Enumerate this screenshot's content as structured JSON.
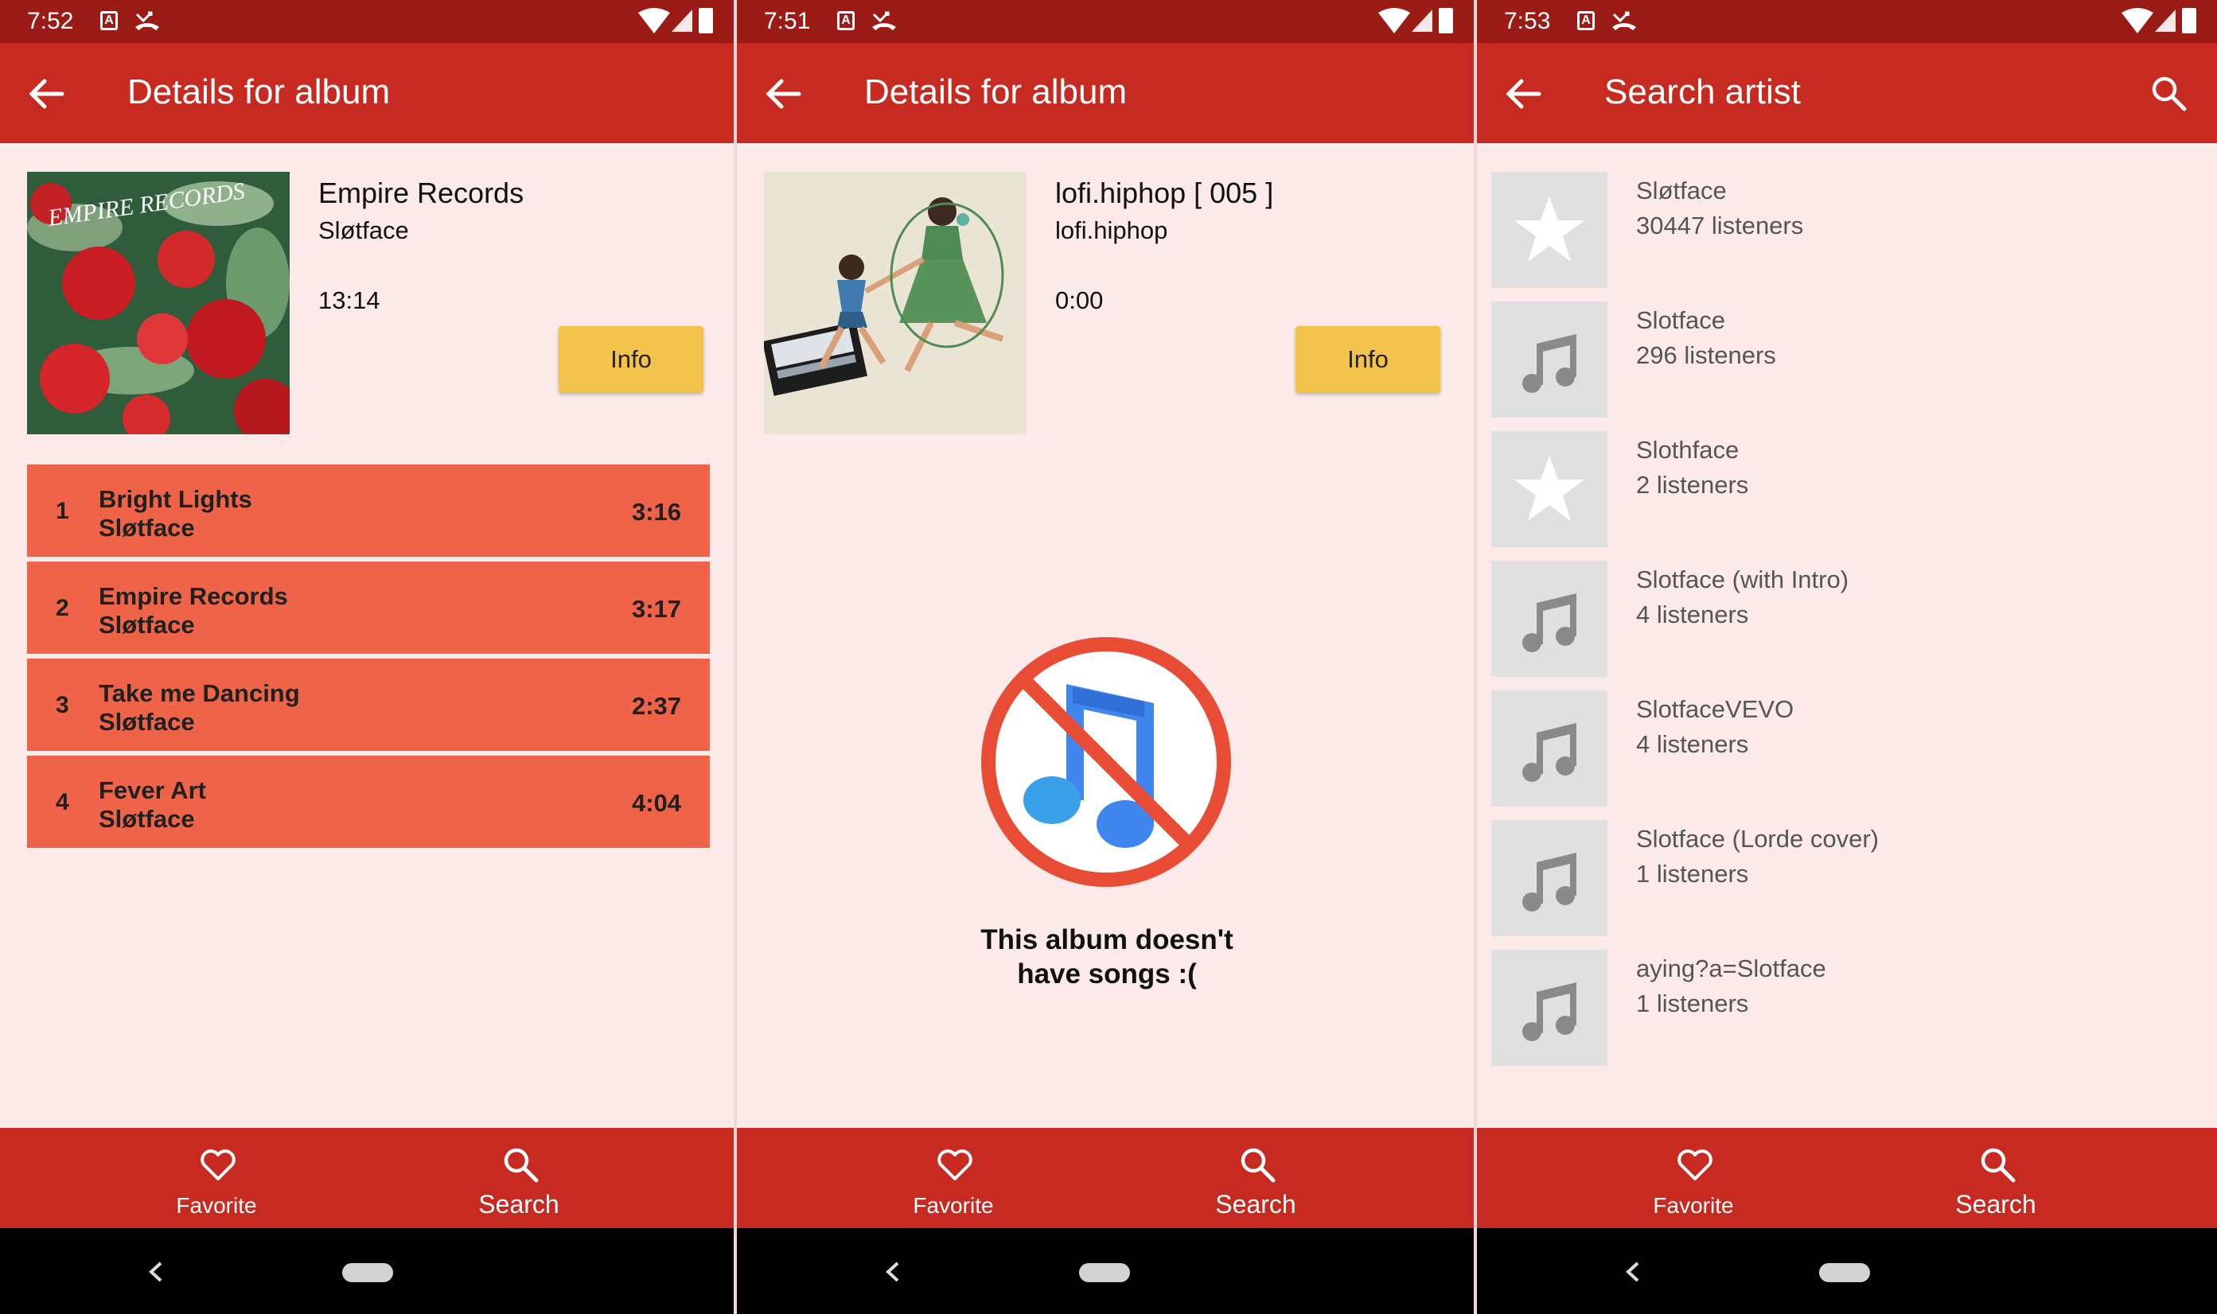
{
  "screens": [
    {
      "status_time": "7:52",
      "appbar_title": "Details for album",
      "album": {
        "title": "Empire Records",
        "artist": "Sløtface",
        "duration": "13:14",
        "info_label": "Info",
        "cover_text": "EMPIRE RECORDS"
      },
      "songs": [
        {
          "num": "1",
          "title": "Bright Lights",
          "artist": "Sløtface",
          "duration": "3:16"
        },
        {
          "num": "2",
          "title": "Empire Records",
          "artist": "Sløtface",
          "duration": "3:17"
        },
        {
          "num": "3",
          "title": "Take me Dancing",
          "artist": "Sløtface",
          "duration": "2:37"
        },
        {
          "num": "4",
          "title": "Fever Art",
          "artist": "Sløtface",
          "duration": "4:04"
        }
      ],
      "nav": {
        "favorite": "Favorite",
        "search": "Search"
      }
    },
    {
      "status_time": "7:51",
      "appbar_title": "Details for album",
      "album": {
        "title": "lofi.hiphop [ 005 ]",
        "artist": "lofi.hiphop",
        "duration": "0:00",
        "info_label": "Info"
      },
      "empty_message_line1": "This album doesn't",
      "empty_message_line2": "have songs :(",
      "nav": {
        "favorite": "Favorite",
        "search": "Search"
      }
    },
    {
      "status_time": "7:53",
      "appbar_title": "Search artist",
      "artists": [
        {
          "name": "Sløtface",
          "listeners": "30447 listeners",
          "icon": "star-icon"
        },
        {
          "name": "Slotface",
          "listeners": "296 listeners",
          "icon": "music-note-icon"
        },
        {
          "name": "Slothface",
          "listeners": "2 listeners",
          "icon": "star-icon"
        },
        {
          "name": "Slotface (with Intro)",
          "listeners": "4 listeners",
          "icon": "music-note-icon"
        },
        {
          "name": "SlotfaceVEVO",
          "listeners": "4 listeners",
          "icon": "music-note-icon"
        },
        {
          "name": "Slotface (Lorde cover)",
          "listeners": "1 listeners",
          "icon": "music-note-icon"
        },
        {
          "name": "aying?a=Slotface",
          "listeners": "1 listeners",
          "icon": "music-note-icon"
        }
      ],
      "nav": {
        "favorite": "Favorite",
        "search": "Search"
      }
    }
  ],
  "colors": {
    "appbar": "#c62a21",
    "statusbar": "#9b1b16",
    "background": "#fceaea",
    "song_row": "#ef6448",
    "info_button": "#f3c24b"
  }
}
